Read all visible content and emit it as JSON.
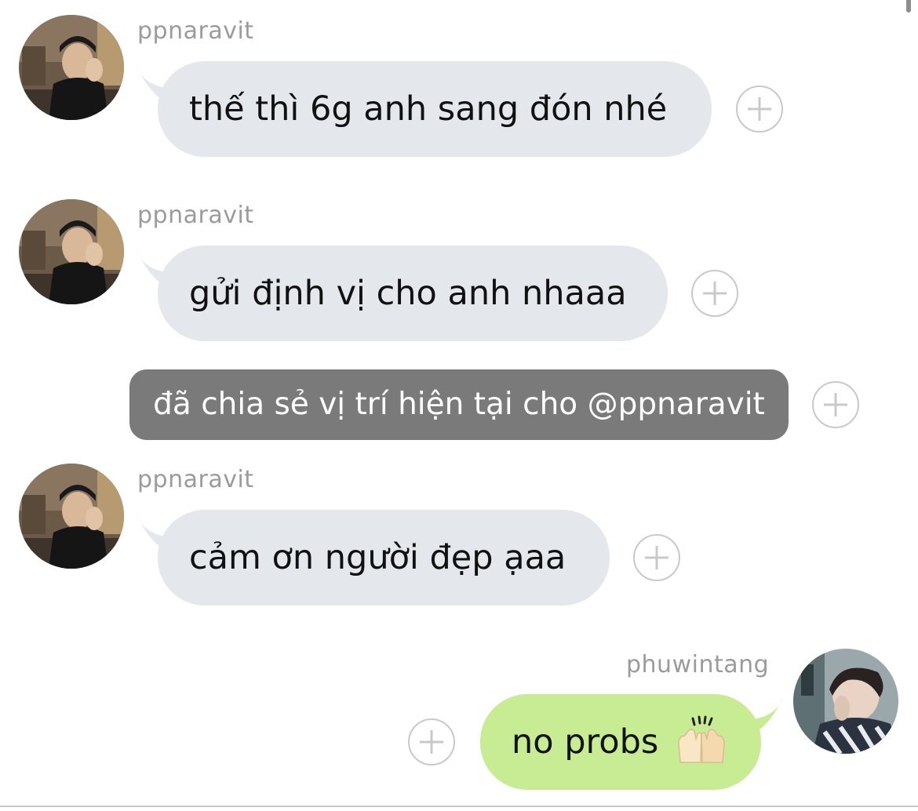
{
  "messages": [
    {
      "sender": "ppnaravit",
      "text": "thế thì 6g anh sang đón nhé"
    },
    {
      "sender": "ppnaravit",
      "text": "gửi định vị cho anh nhaaa"
    },
    {
      "system": "đã chia sẻ vị trí hiện tại cho @ppnaravit"
    },
    {
      "sender": "ppnaravit",
      "text": "cảm ơn người đẹp ạaa"
    },
    {
      "sender": "phuwintang",
      "text": "no probs",
      "emoji": "raising-hands-icon"
    }
  ],
  "colors": {
    "incoming_bubble": "#e4e8ec",
    "outgoing_bubble": "#c8ec94",
    "system_pill": "#7a7a7a",
    "sender_name": "#9b9b9b"
  }
}
